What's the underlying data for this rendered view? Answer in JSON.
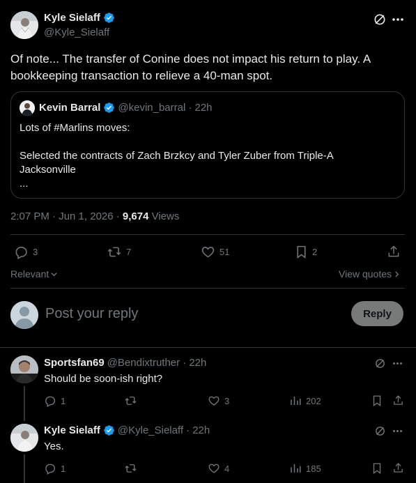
{
  "main_post": {
    "author_name": "Kyle Sielaff",
    "author_handle": "@Kyle_Sielaff",
    "text": "Of note... The transfer of Conine does not impact his return to play. A bookkeeping transaction to relieve a 40-man spot.",
    "quote": {
      "author_name": "Kevin Barral",
      "author_handle": "@kevin_barral",
      "time": "· 22h",
      "line1": "Lots of #Marlins moves:",
      "line2": "Selected the contracts of Zach Brzkcy and Tyler Zuber from Triple-A Jacksonville",
      "line3": "..."
    },
    "timestamp": "2:07 PM · Jun 1, 2026 · ",
    "views_count": "9,674",
    "views_label": " Views",
    "actions": {
      "replies": "3",
      "reposts": "7",
      "likes": "51",
      "bookmarks": "2"
    }
  },
  "sort": {
    "label": "Relevant",
    "view_quotes": "View quotes"
  },
  "composer": {
    "placeholder": "Post your reply",
    "reply_button": "Reply"
  },
  "replies": [
    {
      "author_name": "Sportsfan69",
      "author_handle": "@Bendixtruther",
      "time": "· 22h",
      "text": "Should be soon-ish right?",
      "replies": "1",
      "reposts": "",
      "likes": "3",
      "views": "202"
    },
    {
      "author_name": "Kyle Sielaff",
      "author_handle": "@Kyle_Sielaff",
      "time": "· 22h",
      "text": "Yes.",
      "replies": "1",
      "reposts": "",
      "likes": "4",
      "views": "185"
    }
  ],
  "colors": {
    "background": "#000000",
    "verified": "#1d9bf0",
    "muted": "#71767b",
    "border": "#2f3336"
  }
}
